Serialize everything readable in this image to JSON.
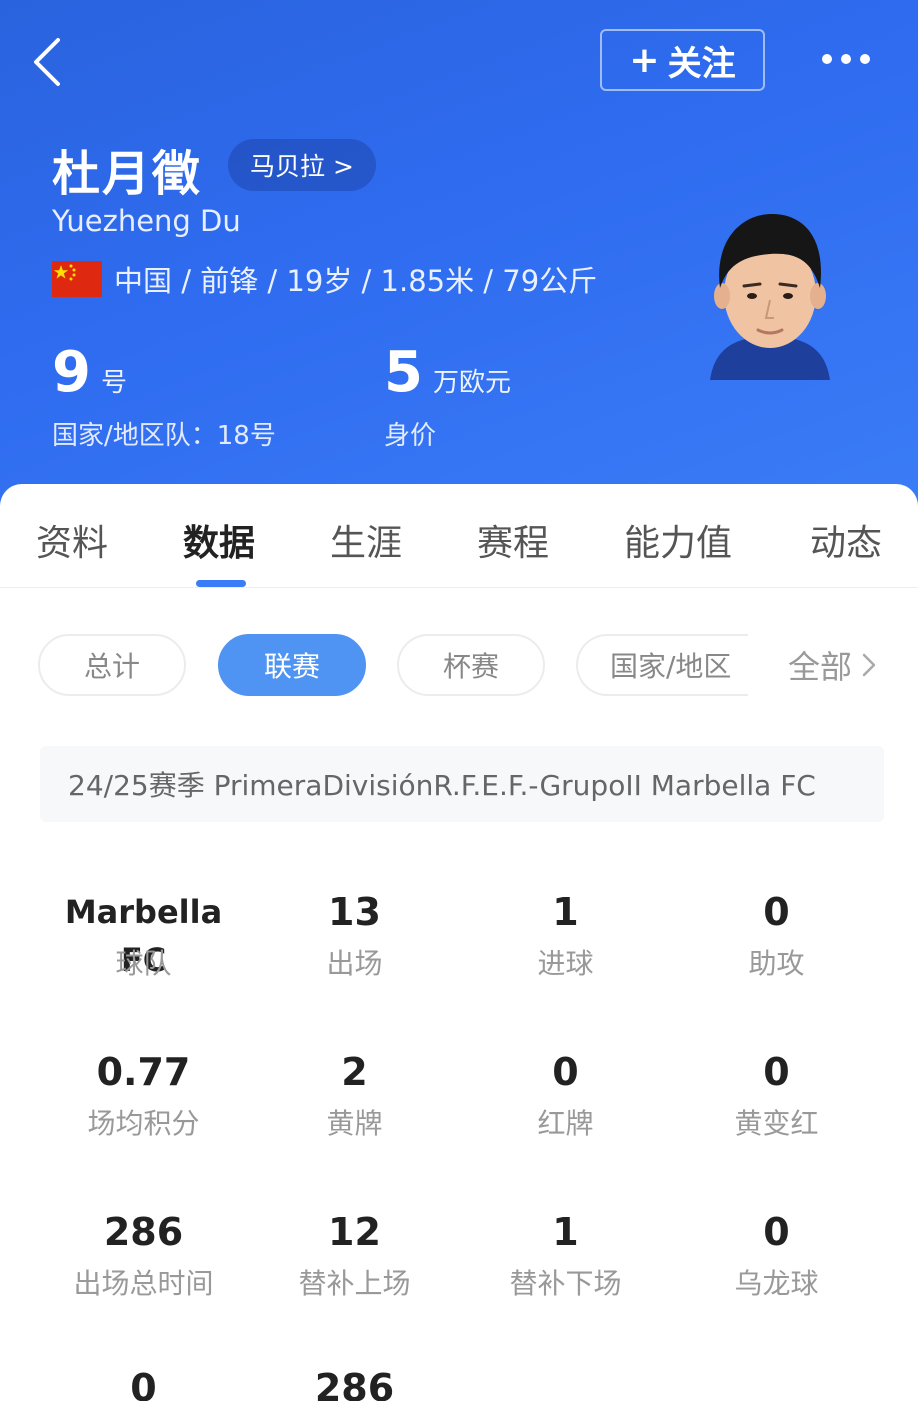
{
  "header": {
    "follow_plus": "+",
    "follow_label": "关注",
    "player_name": "杜月徵",
    "club_pill": "马贝拉 >",
    "english_name": "Yuezheng Du",
    "meta": "中国 / 前锋 / 19岁 / 1.85米 / 79公斤",
    "shirt_number": "9",
    "shirt_unit": "号",
    "national_team": "国家/地区队：18号",
    "market_value": "5",
    "market_value_unit": "万欧元",
    "market_value_label": "身价"
  },
  "tabs": [
    {
      "label": "资料"
    },
    {
      "label": "数据"
    },
    {
      "label": "生涯"
    },
    {
      "label": "赛程"
    },
    {
      "label": "能力值"
    },
    {
      "label": "动态"
    }
  ],
  "filters": {
    "chips": [
      {
        "label": "总计"
      },
      {
        "label": "联赛"
      },
      {
        "label": "杯赛"
      },
      {
        "label": "国家/地区"
      }
    ],
    "all_label": "全部"
  },
  "season": "24/25赛季 PrimeraDivisiónR.F.E.F.-GrupoII Marbella FC",
  "stats": [
    {
      "value": "Marbella FC",
      "label": "球队"
    },
    {
      "value": "13",
      "label": "出场"
    },
    {
      "value": "1",
      "label": "进球"
    },
    {
      "value": "0",
      "label": "助攻"
    },
    {
      "value": "0.77",
      "label": "场均积分"
    },
    {
      "value": "2",
      "label": "黄牌"
    },
    {
      "value": "0",
      "label": "红牌"
    },
    {
      "value": "0",
      "label": "黄变红"
    },
    {
      "value": "286",
      "label": "出场总时间"
    },
    {
      "value": "12",
      "label": "替补上场"
    },
    {
      "value": "1",
      "label": "替补下场"
    },
    {
      "value": "0",
      "label": "乌龙球"
    },
    {
      "value": "0",
      "label": ""
    },
    {
      "value": "286",
      "label": ""
    }
  ],
  "colors": {
    "header_blue": "#2f6cf0",
    "accent": "#3b7df6",
    "chip_active": "#4f94f2"
  }
}
